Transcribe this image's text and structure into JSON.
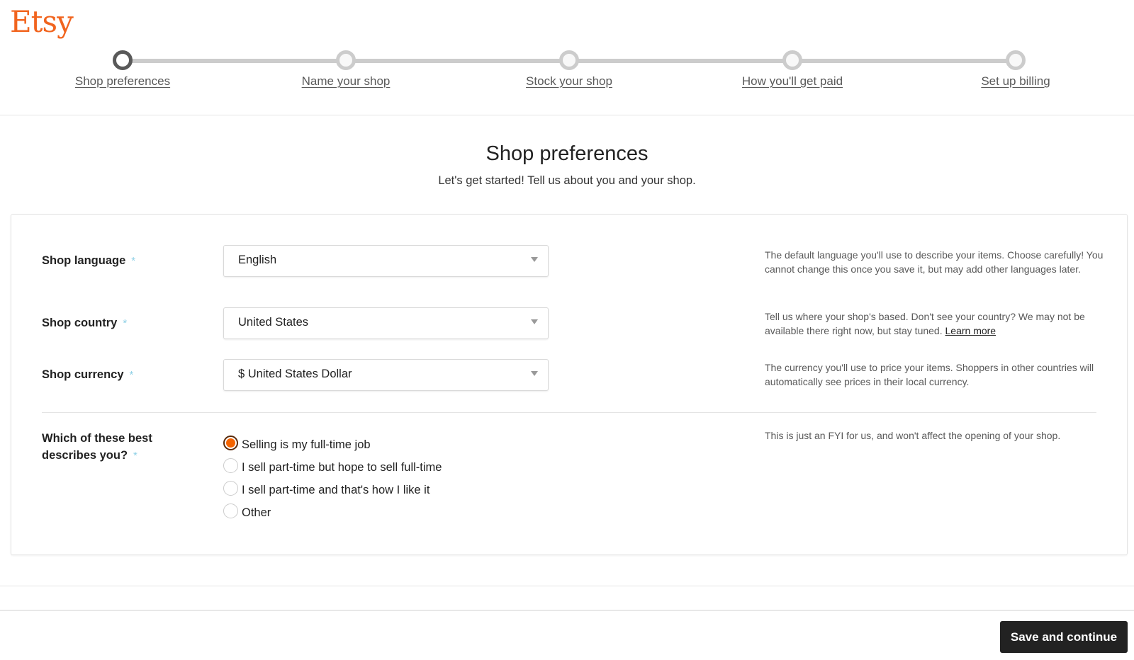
{
  "brand": {
    "name": "Etsy",
    "color": "#f1641e"
  },
  "stepper": {
    "current_index": 0,
    "steps": [
      {
        "label": "Shop preferences",
        "state": "active"
      },
      {
        "label": "Name your shop",
        "state": "pending"
      },
      {
        "label": "Stock your shop",
        "state": "pending"
      },
      {
        "label": "How you'll get paid",
        "state": "pending"
      },
      {
        "label": "Set up billing",
        "state": "pending"
      }
    ]
  },
  "page": {
    "title": "Shop preferences",
    "subtitle": "Let's get started! Tell us about you and your shop."
  },
  "form": {
    "required_marker": "*",
    "language": {
      "label": "Shop language",
      "value": "English",
      "help": "The default language you'll use to describe your items. Choose carefully! You cannot change this once you save it, but may add other languages later."
    },
    "country": {
      "label": "Shop country",
      "value": "United States",
      "help": "Tell us where your shop's based. Don't see your country? We may not be available there right now, but stay tuned.",
      "help_link": "Learn more"
    },
    "currency": {
      "label": "Shop currency",
      "value": "$ United States Dollar",
      "help": "The currency you'll use to price your items. Shoppers in other countries will automatically see prices in their local currency."
    },
    "describes_you": {
      "label_line1": "Which of these best",
      "label_line2": "describes you?",
      "help": "This is just an FYI for us, and won't affect the opening of your shop.",
      "selected_index": 0,
      "options": [
        "Selling is my full-time job",
        "I sell part-time but hope to sell full-time",
        "I sell part-time and that's how I like it",
        "Other"
      ]
    }
  },
  "footer": {
    "save_label": "Save and continue"
  },
  "colors": {
    "accent": "#f56400",
    "button_bg": "#222222",
    "required": "#8ed0e6"
  }
}
